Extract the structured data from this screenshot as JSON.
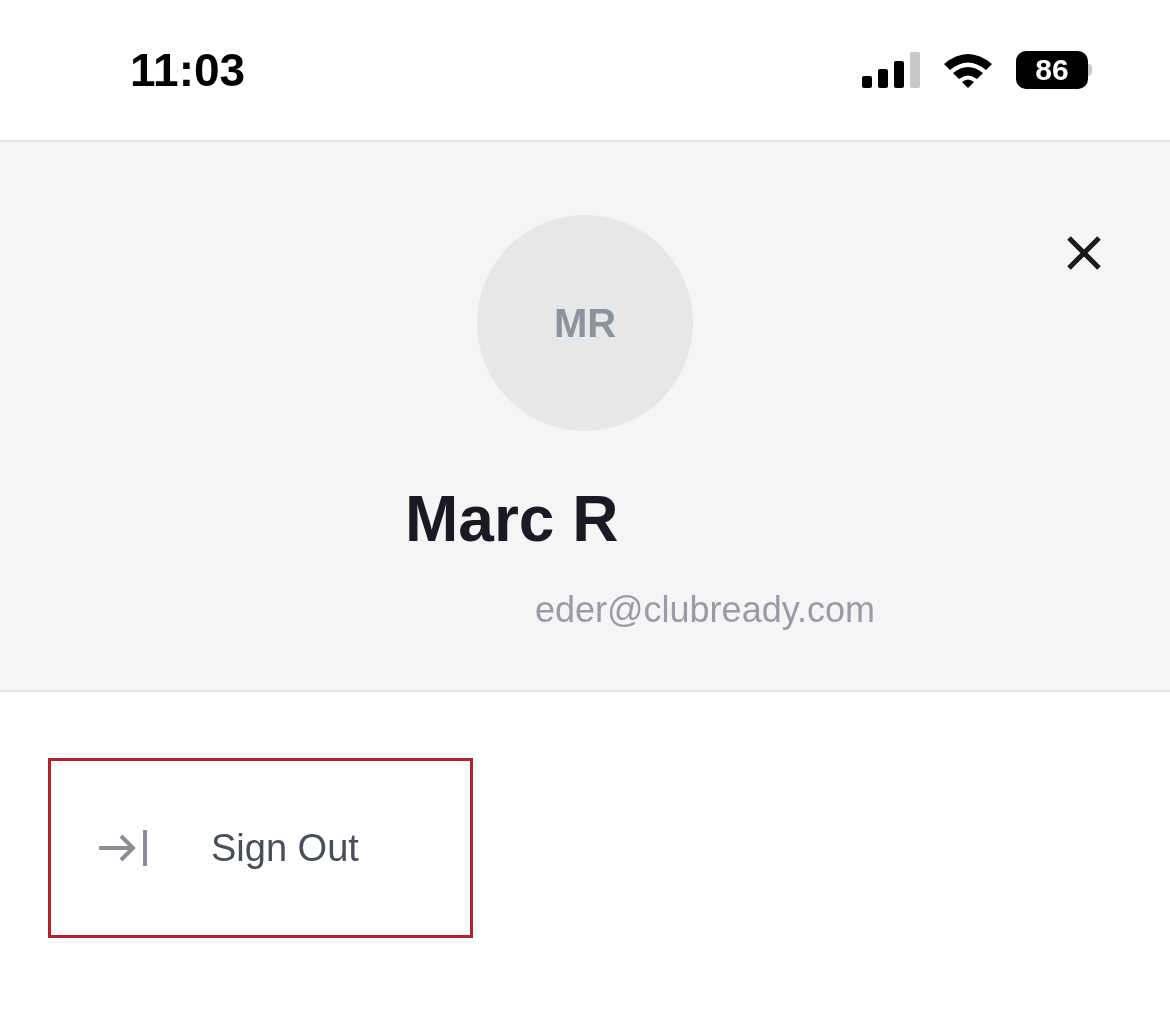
{
  "status_bar": {
    "time": "11:03",
    "battery": "86"
  },
  "profile": {
    "initials": "MR",
    "name": "Marc R",
    "email": "eder@clubready.com"
  },
  "menu": [
    {
      "label": "Sign Out",
      "highlighted": true
    }
  ]
}
